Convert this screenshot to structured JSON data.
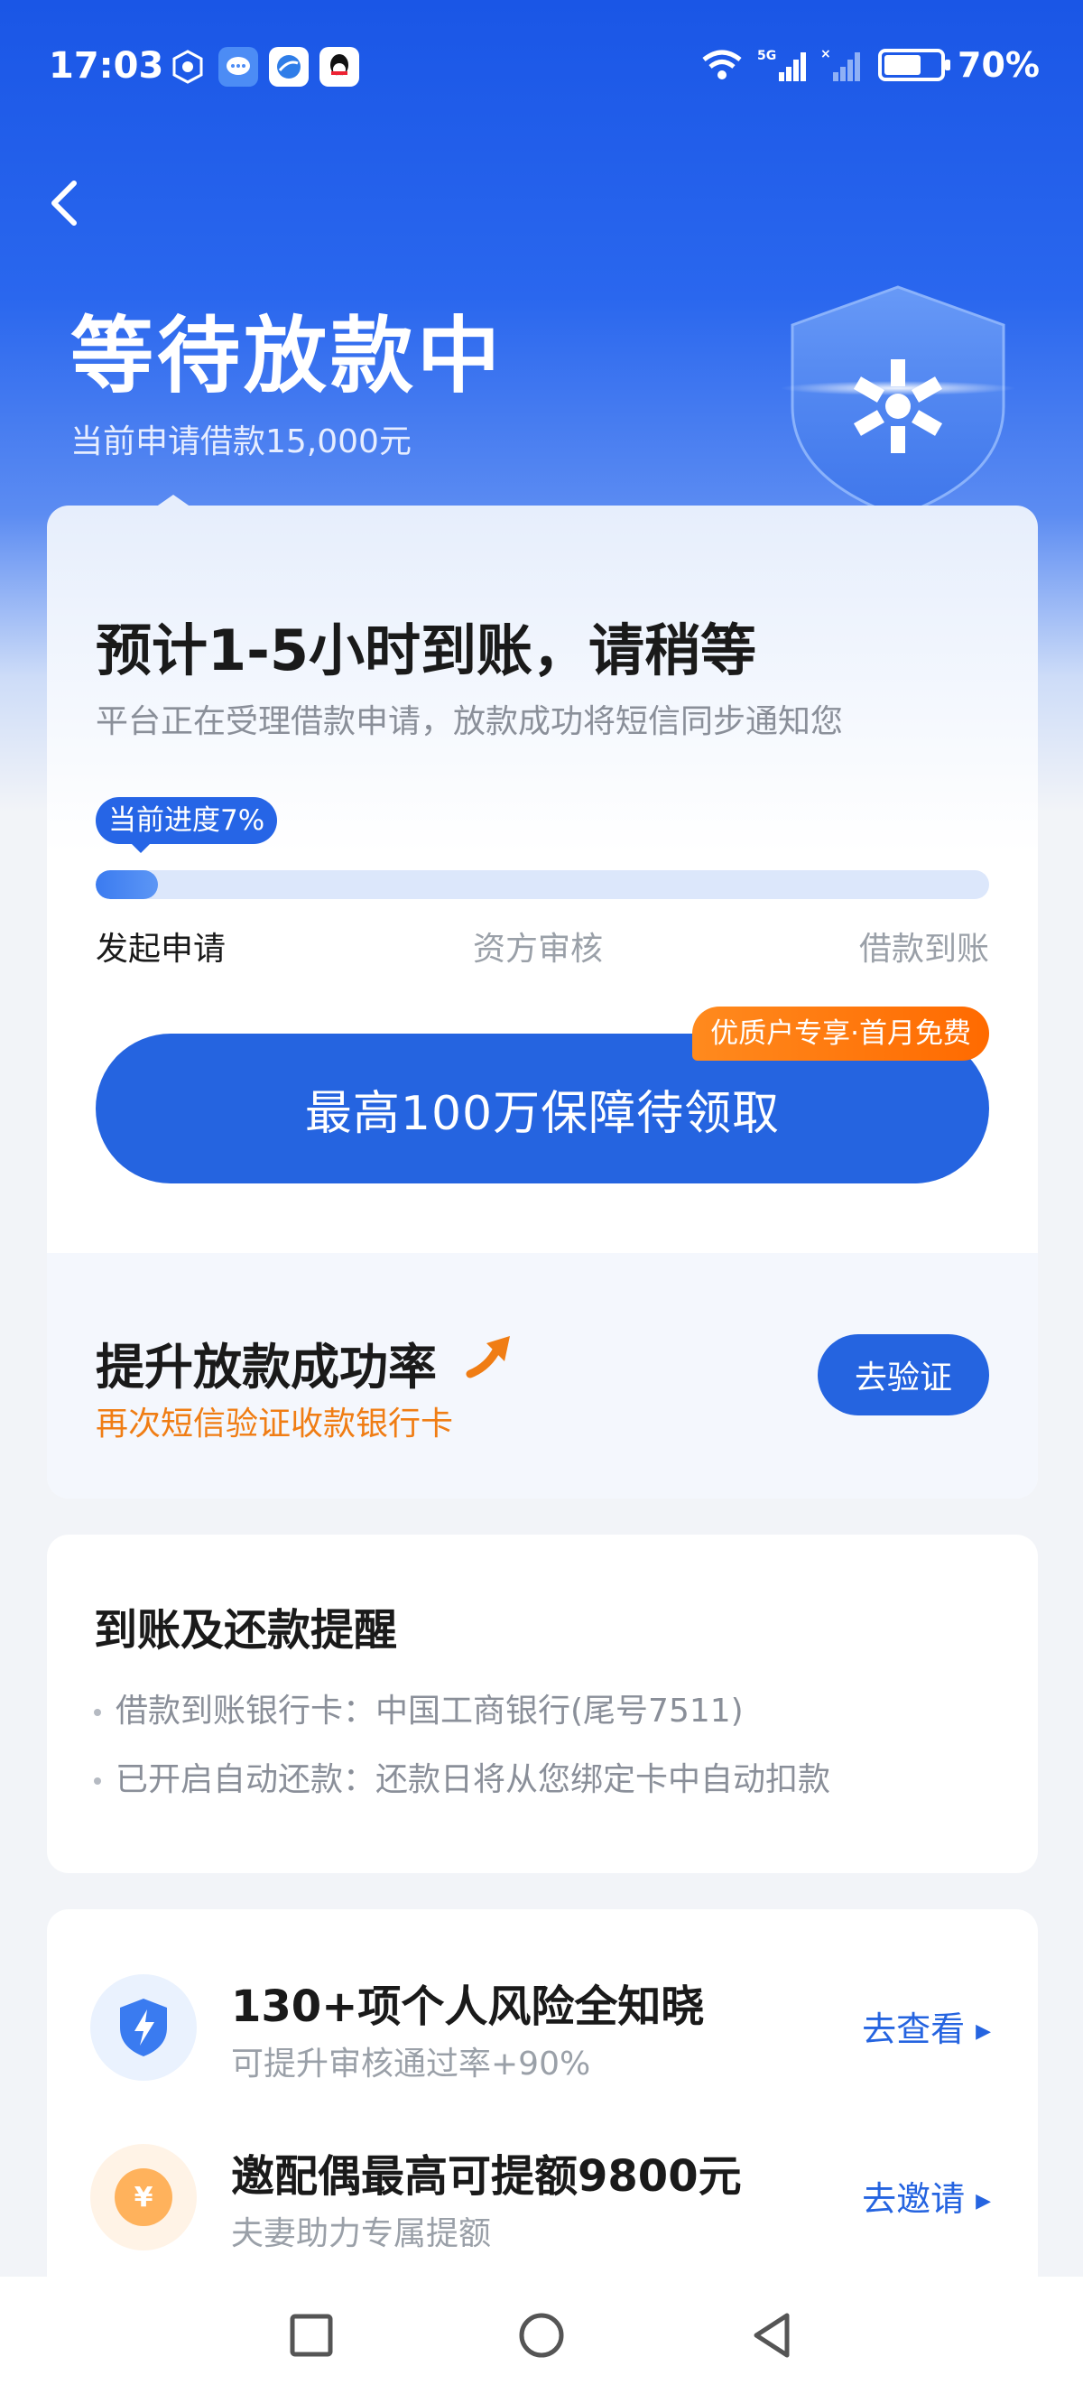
{
  "status_bar": {
    "time": "17:03",
    "battery": "70%",
    "battery_level": 0.7,
    "apps": [
      "shield-app",
      "message-app",
      "browser-app",
      "qq-app"
    ],
    "network": "5G"
  },
  "header": {
    "title": "等待放款中",
    "subtitle": "当前申请借款15,000元"
  },
  "progress_card": {
    "eta": "预计1-5小时到账，请稍等",
    "eta_sub": "平台正在受理借款申请，放款成功将短信同步通知您",
    "progress_label": "当前进度7%",
    "progress": 0.07,
    "stages": [
      "发起申请",
      "资方审核",
      "借款到账"
    ],
    "cta_label": "最高100万保障待领取",
    "cta_badge": "优质户专享·首月免费",
    "boost_title": "提升放款成功率",
    "boost_sub": "再次短信验证收款银行卡",
    "verify_label": "去验证"
  },
  "remind_card": {
    "title": "到账及还款提醒",
    "items": [
      "借款到账银行卡：中国工商银行(尾号7511)",
      "已开启自动还款：还款日将从您绑定卡中自动扣款"
    ]
  },
  "extra_card": {
    "rows": [
      {
        "title": "130+项个人风险全知晓",
        "sub": "可提升审核通过率+90%",
        "link": "去查看",
        "icon": "lightning-shield-icon"
      },
      {
        "title": "邀配偶最高可提额9800元",
        "sub": "夫妻助力专属提额",
        "link": "去邀请",
        "icon": "yuan-icon",
        "icon_text": "¥"
      }
    ]
  },
  "colors": {
    "primary": "#2564e0",
    "accent_orange": "#f07d14",
    "hero_blue": "#1a56e6"
  }
}
